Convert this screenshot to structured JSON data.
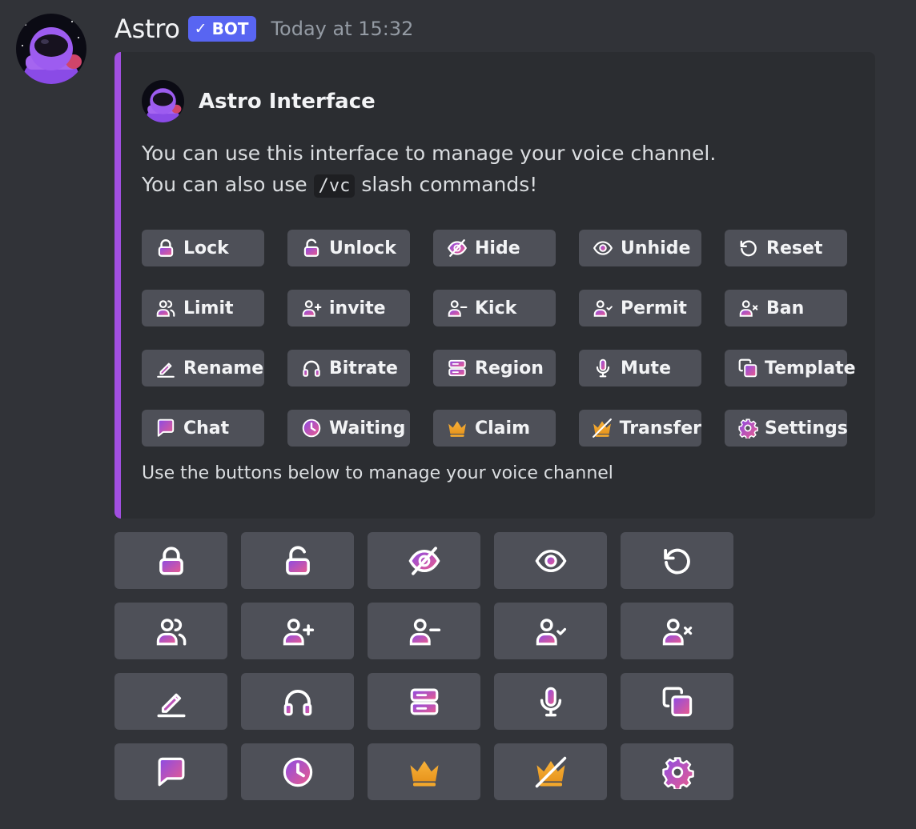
{
  "message": {
    "username": "Astro",
    "bot_badge": "BOT",
    "bot_badge_check": "✓",
    "timestamp": "Today at 15:32"
  },
  "embed": {
    "accent_color": "#a14fe0",
    "author": "Astro Interface",
    "description_line1": "You can use this interface to manage your voice channel.",
    "description_line2_before": "You can also use",
    "description_code": "/vc",
    "description_line2_after": "slash commands!",
    "footer": "Use the buttons below to manage your voice channel",
    "legend": [
      {
        "icon": "lock-icon",
        "label": "Lock"
      },
      {
        "icon": "unlock-icon",
        "label": "Unlock"
      },
      {
        "icon": "eye-slash-icon",
        "label": "Hide"
      },
      {
        "icon": "eye-icon",
        "label": "Unhide"
      },
      {
        "icon": "reset-icon",
        "label": "Reset"
      },
      {
        "icon": "users-icon",
        "label": "Limit"
      },
      {
        "icon": "user-plus-icon",
        "label": "invite"
      },
      {
        "icon": "user-minus-icon",
        "label": "Kick"
      },
      {
        "icon": "user-check-icon",
        "label": "Permit"
      },
      {
        "icon": "user-x-icon",
        "label": "Ban"
      },
      {
        "icon": "pencil-icon",
        "label": "Rename"
      },
      {
        "icon": "headphones-icon",
        "label": "Bitrate"
      },
      {
        "icon": "server-icon",
        "label": "Region"
      },
      {
        "icon": "microphone-icon",
        "label": "Mute"
      },
      {
        "icon": "copy-icon",
        "label": "Template"
      },
      {
        "icon": "chat-icon",
        "label": "Chat"
      },
      {
        "icon": "clock-icon",
        "label": "Waiting"
      },
      {
        "icon": "crown-icon",
        "label": "Claim"
      },
      {
        "icon": "crown-slash-icon",
        "label": "Transfer"
      },
      {
        "icon": "gear-icon",
        "label": "Settings"
      }
    ]
  },
  "buttons": [
    {
      "icon": "lock-icon",
      "action": "lock"
    },
    {
      "icon": "unlock-icon",
      "action": "unlock"
    },
    {
      "icon": "eye-slash-icon",
      "action": "hide"
    },
    {
      "icon": "eye-icon",
      "action": "unhide"
    },
    {
      "icon": "reset-icon",
      "action": "reset"
    },
    {
      "icon": "users-icon",
      "action": "limit"
    },
    {
      "icon": "user-plus-icon",
      "action": "invite"
    },
    {
      "icon": "user-minus-icon",
      "action": "kick"
    },
    {
      "icon": "user-check-icon",
      "action": "permit"
    },
    {
      "icon": "user-x-icon",
      "action": "ban"
    },
    {
      "icon": "pencil-icon",
      "action": "rename"
    },
    {
      "icon": "headphones-icon",
      "action": "bitrate"
    },
    {
      "icon": "server-icon",
      "action": "region"
    },
    {
      "icon": "microphone-icon",
      "action": "mute"
    },
    {
      "icon": "copy-icon",
      "action": "template"
    },
    {
      "icon": "chat-icon",
      "action": "chat"
    },
    {
      "icon": "clock-icon",
      "action": "waiting"
    },
    {
      "icon": "crown-icon",
      "action": "claim"
    },
    {
      "icon": "crown-slash-icon",
      "action": "transfer"
    },
    {
      "icon": "gear-icon",
      "action": "settings"
    }
  ],
  "colors": {
    "background": "#313338",
    "embed_background": "#2b2d31",
    "button_background": "#4e5058",
    "bot_badge": "#5865f2",
    "icon_gradient_start": "#8a4be6",
    "icon_gradient_end": "#ec5c8a",
    "crown": "#f2a72c"
  }
}
